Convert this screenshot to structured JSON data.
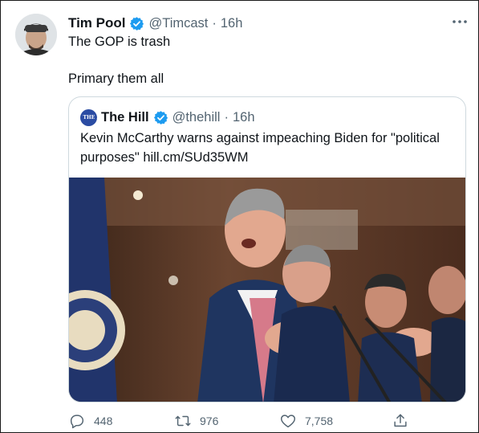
{
  "tweet": {
    "author_name": "Tim Pool",
    "author_handle": "@Timcast",
    "separator": "·",
    "time": "16h",
    "text_line1": "The GOP is trash",
    "text_line2": "Primary them all"
  },
  "quoted_tweet": {
    "avatar_text": "THE HILL",
    "author_name": "The Hill",
    "author_handle": "@thehill",
    "separator": "·",
    "time": "16h",
    "text_line1": "Kevin McCarthy warns against impeaching Biden for \"political",
    "text_line2_prefix": "purposes\" ",
    "link": "hill.cm/SUd35WM"
  },
  "actions": {
    "replies": "448",
    "retweets": "976",
    "likes": "7,758"
  },
  "colors": {
    "verified": "#1d9bf0",
    "text": "#0f1419",
    "muted": "#536471",
    "border": "#cfd9de",
    "hill_brand": "#2b4ca3"
  },
  "icons": {
    "more": "more-icon",
    "reply": "reply-icon",
    "retweet": "retweet-icon",
    "like": "heart-icon",
    "share": "share-icon",
    "verified": "verified-badge-icon"
  }
}
